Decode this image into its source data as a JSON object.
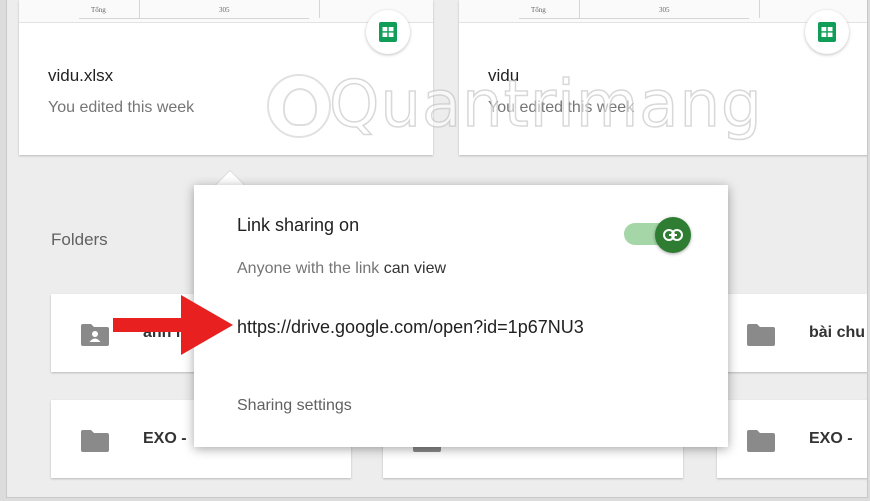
{
  "recent_files": [
    {
      "name": "vidu.xlsx",
      "meta": "You edited this week",
      "thumb_cells": [
        "Tổng",
        "305"
      ],
      "type_icon": "google-sheets-icon"
    },
    {
      "name": "vidu",
      "meta": "You edited this week",
      "thumb_cells": [
        "Tổng",
        "305"
      ],
      "type_icon": "google-sheets-icon"
    }
  ],
  "watermark": {
    "text": "Quantrimang",
    "icon": "lightbulb-icon"
  },
  "folders_section": {
    "label": "Folders"
  },
  "folders": [
    {
      "name": "anh r",
      "icon": "shared-folder-icon"
    },
    {
      "name": "bài chu",
      "icon": "folder-icon"
    },
    {
      "name": "EXO -",
      "icon": "folder-icon"
    },
    {
      "name": "",
      "icon": "folder-icon"
    },
    {
      "name": "EXO -",
      "icon": "folder-icon"
    }
  ],
  "share_popup": {
    "title": "Link sharing on",
    "subtitle_prefix": "Anyone with the link",
    "subtitle_access": "can view",
    "url": "https://drive.google.com/open?id=1p67NU3",
    "settings_link": "Sharing settings",
    "toggle_state": "on",
    "toggle_icon": "link-icon"
  },
  "colors": {
    "sheets_green": "#0f9d58",
    "toggle_knob": "#2e7d32",
    "toggle_track": "#a5d6a7",
    "annotation_arrow": "#e8201f",
    "folder_gray": "#8a8a8a"
  }
}
